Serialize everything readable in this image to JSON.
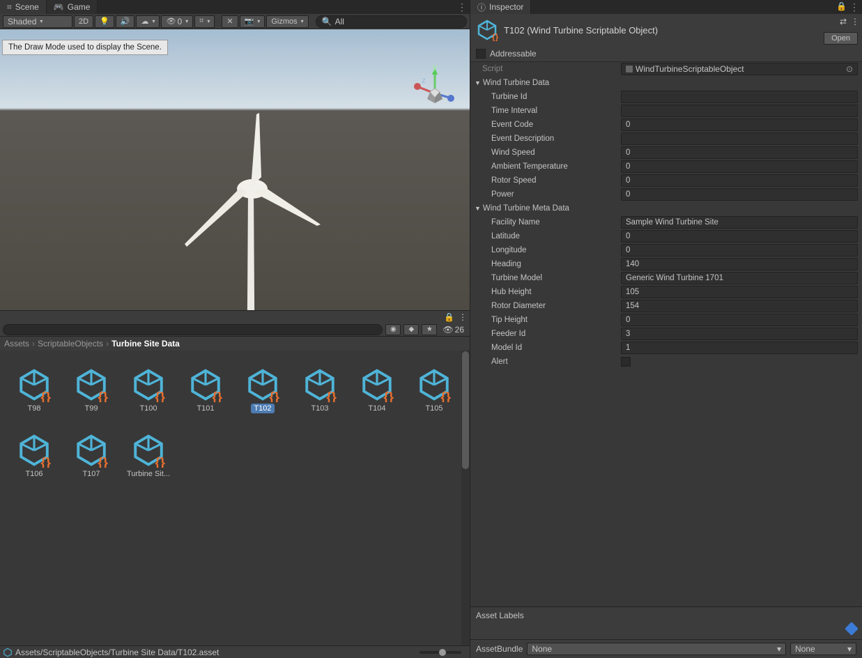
{
  "tabs": {
    "scene": "Scene",
    "game": "Game",
    "inspector": "Inspector"
  },
  "toolbar": {
    "shading": "Shaded",
    "mode2d": "2D",
    "gizmos": "Gizmos",
    "search": "All",
    "eyeCount": "0"
  },
  "tooltip": "The Draw Mode used to display the Scene.",
  "breadcrumb": {
    "a": "Assets",
    "b": "ScriptableObjects",
    "c": "Turbine Site Data"
  },
  "hiddenCount": "26",
  "assets": [
    "T98",
    "T99",
    "T100",
    "T101",
    "T102",
    "T103",
    "T104",
    "T105",
    "T106",
    "T107",
    "Turbine Sit..."
  ],
  "selectedAsset": "T102",
  "statusPath": "Assets/ScriptableObjects/Turbine Site Data/T102.asset",
  "inspector": {
    "title": "T102 (Wind Turbine Scriptable Object)",
    "open": "Open",
    "addressable": "Addressable",
    "scriptLabel": "Script",
    "scriptValue": "WindTurbineScriptableObject",
    "section1": "Wind Turbine Data",
    "section2": "Wind Turbine Meta Data",
    "fields1": [
      {
        "label": "Turbine Id",
        "value": ""
      },
      {
        "label": "Time Interval",
        "value": ""
      },
      {
        "label": "Event Code",
        "value": "0"
      },
      {
        "label": "Event Description",
        "value": ""
      },
      {
        "label": "Wind Speed",
        "value": "0"
      },
      {
        "label": "Ambient Temperature",
        "value": "0"
      },
      {
        "label": "Rotor Speed",
        "value": "0"
      },
      {
        "label": "Power",
        "value": "0"
      }
    ],
    "fields2": [
      {
        "label": "Facility Name",
        "value": "Sample Wind Turbine Site"
      },
      {
        "label": "Latitude",
        "value": "0"
      },
      {
        "label": "Longitude",
        "value": "0"
      },
      {
        "label": "Heading",
        "value": "140"
      },
      {
        "label": "Turbine Model",
        "value": "Generic Wind Turbine 1701"
      },
      {
        "label": "Hub Height",
        "value": "105"
      },
      {
        "label": "Rotor Diameter",
        "value": "154"
      },
      {
        "label": "Tip Height",
        "value": "0"
      },
      {
        "label": "Feeder Id",
        "value": "3"
      },
      {
        "label": "Model Id",
        "value": "1"
      }
    ],
    "alertLabel": "Alert",
    "assetLabels": "Asset Labels",
    "assetBundle": "AssetBundle",
    "none": "None"
  }
}
